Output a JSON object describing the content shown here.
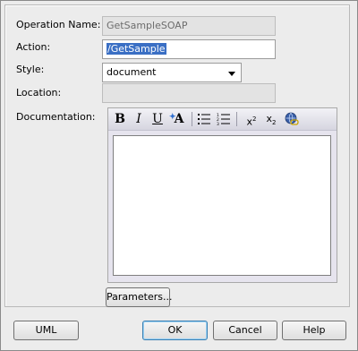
{
  "form": {
    "operation_name_label": "Operation Name:",
    "operation_name_value": "GetSampleSOAP",
    "action_label": "Action:",
    "action_value": "/GetSample",
    "style_label": "Style:",
    "style_value": "document",
    "location_label": "Location:",
    "location_value": "",
    "documentation_label": "Documentation:"
  },
  "editor_toolbar": {
    "bold": "B",
    "italic": "I",
    "underline": "U",
    "font": "A",
    "superscript_base": "x",
    "superscript_exp": "2",
    "subscript_base": "x",
    "subscript_exp": "2"
  },
  "buttons": {
    "parameters": "Parameters...",
    "uml": "UML",
    "ok": "OK",
    "cancel": "Cancel",
    "help": "Help"
  },
  "colors": {
    "selection": "#3a6fc4",
    "default_button_border": "#3c7fb1"
  }
}
